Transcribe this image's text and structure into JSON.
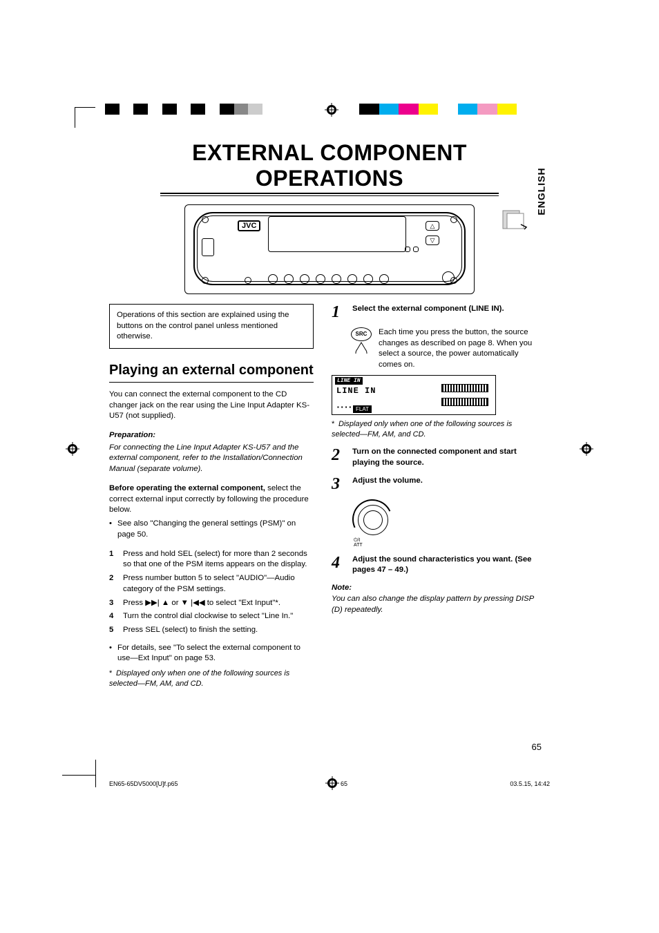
{
  "title": "EXTERNAL COMPONENT OPERATIONS",
  "language_tab": "ENGLISH",
  "device_logo": "JVC",
  "intro_box": "Operations of this section are explained using the buttons on the control panel unless mentioned otherwise.",
  "section_heading": "Playing an external component",
  "left": {
    "p1": "You can connect the external component to the CD changer jack on the rear using the Line Input Adapter KS-U57 (not supplied).",
    "prep_head": "Preparation:",
    "prep_body": "For connecting the Line Input Adapter KS-U57 and the external component, refer to the Installation/Connection Manual (separate volume).",
    "before_head": "Before operating the external component,",
    "before_body": "select the correct external input correctly by following the procedure below.",
    "bullet1": "See also \"Changing the general settings (PSM)\" on page 50.",
    "steps": [
      {
        "n": "1",
        "t": "Press and hold SEL (select) for more than 2 seconds so that one of the PSM items appears on the display."
      },
      {
        "n": "2",
        "t": "Press number button 5 to select \"AUDIO\"—Audio category of the PSM settings."
      },
      {
        "n": "3",
        "t_pre": "Press ",
        "t_mid_a": "▶▶| ▲",
        "t_mid_or": " or ",
        "t_mid_b": "▼ |◀◀",
        "t_post": " to select \"Ext Input\"*."
      },
      {
        "n": "4",
        "t": "Turn the control dial clockwise to select \"Line In.\""
      },
      {
        "n": "5",
        "t": "Press SEL (select) to finish the setting."
      }
    ],
    "bullet2": "For details, see \"To select the external component to use—Ext Input\" on page 53.",
    "foot_ast": "*",
    "foot_text": "Displayed only when one of the following sources is selected—FM, AM, and CD."
  },
  "right": {
    "step1_head": "Select the external component (LINE IN).",
    "step1_body": "Each time you press the button, the source changes as described on page 8. When you select a source, the power automatically comes on.",
    "src_label": "SRC",
    "disp_badge": "LINE IN",
    "disp_text": "LINE IN",
    "disp_flat": "FLAT",
    "disp_foot_ast": "*",
    "disp_foot": "Displayed only when one of the following sources is selected—FM, AM, and CD.",
    "step2_head": "Turn on the connected component and start playing the source.",
    "step3_head": "Adjust the volume.",
    "dial_label_top": "ATT",
    "step4_head": "Adjust the sound characteristics you want. (See pages 47 – 49.)",
    "note_head": "Note:",
    "note_body": "You can also change the display pattern by pressing DISP (D) repeatedly."
  },
  "page_number": "65",
  "footer": {
    "file": "EN65-65DV5000[U]f.p65",
    "page": "65",
    "timestamp": "03.5.15, 14:42"
  },
  "step_nums": {
    "s1": "1",
    "s2": "2",
    "s3": "3",
    "s4": "4"
  }
}
